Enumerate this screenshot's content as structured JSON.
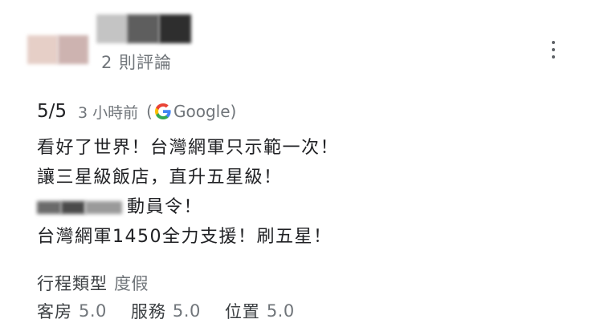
{
  "reviewer": {
    "review_count": "2 則評論"
  },
  "review": {
    "rating": "5/5",
    "time_ago": "3 小時前",
    "source_open": "(",
    "source_name": "Google)",
    "lines": [
      "看好了世界！台灣網軍只示範一次！",
      "讓三星級飯店，直升五星級！",
      "動員令！",
      "台灣網軍1450全力支援！刷五星！"
    ],
    "trip_type_label": "行程類型",
    "trip_type_value": "度假",
    "ratings": [
      {
        "label": "客房",
        "value": "5.0"
      },
      {
        "label": "服務",
        "value": "5.0"
      },
      {
        "label": "位置",
        "value": "5.0"
      }
    ]
  },
  "icons": {
    "more": "more-vert-icon",
    "google": "google-g-icon"
  },
  "colors": {
    "text": "#202124",
    "secondary": "#70757a",
    "google_blue": "#4285F4",
    "google_red": "#EA4335",
    "google_yellow": "#FBBC05",
    "google_green": "#34A853"
  }
}
